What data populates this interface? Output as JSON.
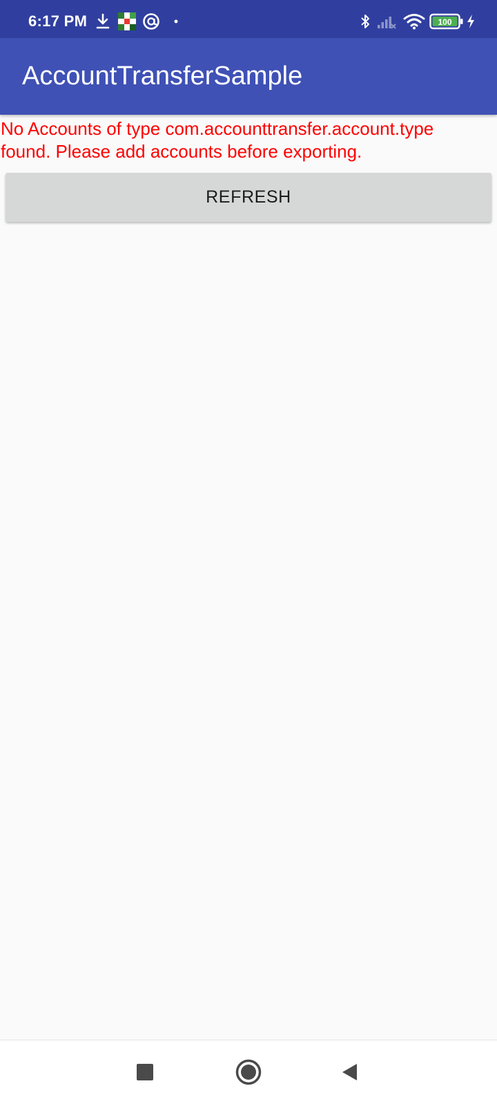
{
  "status_bar": {
    "time": "6:17 PM",
    "battery_level": "100",
    "icons": {
      "download": "download-icon",
      "app_notification": "app-notification-icon",
      "at_sign": "at-sign-icon",
      "dot": "notification-dot-icon",
      "bluetooth": "bluetooth-icon",
      "signal": "cellular-signal-icon",
      "wifi": "wifi-icon",
      "battery": "battery-icon",
      "charging": "charging-bolt-icon"
    }
  },
  "app_bar": {
    "title": "AccountTransferSample"
  },
  "main": {
    "message": "No Accounts of type com.accounttransfer.account.type found. Please add accounts before exporting.",
    "refresh_label": "REFRESH"
  },
  "nav_bar": {
    "recents_icon": "recents-square-icon",
    "home_icon": "home-circle-icon",
    "back_icon": "back-triangle-icon"
  },
  "colors": {
    "status_bar": "#303f9f",
    "app_bar": "#3f51b5",
    "message_text": "#ff0000",
    "button_bg": "#d6d7d7",
    "background": "#fafafa"
  }
}
